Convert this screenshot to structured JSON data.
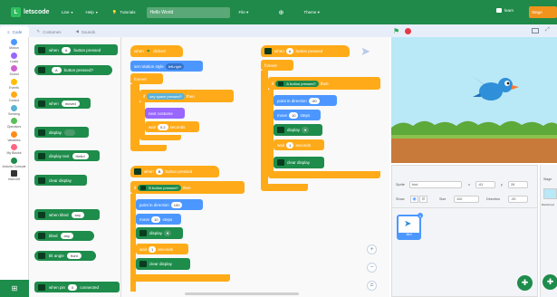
{
  "topbar": {
    "logo_text": "letscode",
    "menu": [
      {
        "label": "Line"
      },
      {
        "label": "Help"
      }
    ],
    "tutorials_label": "Tutorials",
    "project_title": "Hello World",
    "file_label": "File",
    "theme_label": "Theme",
    "learn_label": "learn",
    "stage_label": "Stage"
  },
  "tabs": [
    {
      "label": "Code"
    },
    {
      "label": "Costumes"
    },
    {
      "label": "Sounds"
    }
  ],
  "categories": [
    {
      "label": "Motion",
      "color": "#4c97ff"
    },
    {
      "label": "Looks",
      "color": "#9966ff"
    },
    {
      "label": "Sound",
      "color": "#cf63cf"
    },
    {
      "label": "Events",
      "color": "#ffbf00"
    },
    {
      "label": "Control",
      "color": "#ffab19"
    },
    {
      "label": "Sensing",
      "color": "#5cb1d6"
    },
    {
      "label": "Operators",
      "color": "#59c059"
    },
    {
      "label": "Variables",
      "color": "#ff8c1a"
    },
    {
      "label": "My Blocks",
      "color": "#ff6680"
    },
    {
      "label": "Arduino Console",
      "color": "#1e8c4b"
    },
    {
      "label": "micro:bit",
      "color": "#333333"
    }
  ],
  "palette": {
    "b1": "when",
    "b1_key": "A",
    "b1_end": "button pressed",
    "b2_key": "A",
    "b2_end": "button pressed?",
    "b3": "when",
    "b3_val": "moved",
    "b4": "display",
    "b5": "display text",
    "b5_val": "Hello!",
    "b6": "clear display",
    "b7": "when tilted",
    "b7_val": "any",
    "b8": "tilted",
    "b8_val": "any",
    "b9": "tilt angle",
    "b9_val": "front",
    "b10": "when pin",
    "b10_val": "0",
    "b10_end": "connected"
  },
  "script1": {
    "hat": "when",
    "hat_end": "clicked",
    "rot": "set rotation style",
    "rot_val": "left-right",
    "forever": "forever",
    "if": "if",
    "key": "key",
    "key_val": "space",
    "pressed": "pressed?",
    "then": "then",
    "next": "next costume",
    "wait": "wait",
    "wait_val": "0.2",
    "seconds": "seconds"
  },
  "script2": {
    "hat": "when",
    "hat_key": "B",
    "hat_end": "button pressed",
    "if": "if",
    "if_key": "B",
    "if_end": "button pressed?",
    "then": "then",
    "point": "point in direction",
    "point_val": "100",
    "move": "move",
    "move_val": "10",
    "steps": "steps",
    "display": "display",
    "wait": "wait",
    "wait_val": "1",
    "seconds": "seconds",
    "clear": "clear display"
  },
  "script3": {
    "hat": "when",
    "hat_key": "A",
    "hat_end": "button pressed",
    "forever": "forever",
    "if": "if",
    "if_key": "A",
    "if_end": "button pressed?",
    "then": "then",
    "point": "point in direction",
    "point_val": "-90",
    "move": "move",
    "move_val": "10",
    "steps": "steps",
    "display": "display",
    "wait": "wait",
    "wait_val": "1",
    "seconds": "seconds",
    "clear": "clear display"
  },
  "sprite_info": {
    "sprite_label": "Sprite",
    "sprite_name": "bird",
    "x_label": "x",
    "x_val": "-61",
    "y_label": "y",
    "y_val": "26",
    "show_label": "Show",
    "size_label": "Size",
    "size_val": "100",
    "direction_label": "Direction",
    "direction_val": "-90",
    "thumb_name": "bird",
    "stage_label": "Stage",
    "backdrops_label": "Backdrops"
  },
  "colors": {
    "topbar": "#1f8a4a",
    "control": "#ffab19",
    "motion": "#4c97ff",
    "microbit": "#1e8c4b",
    "looks": "#9966ff"
  }
}
